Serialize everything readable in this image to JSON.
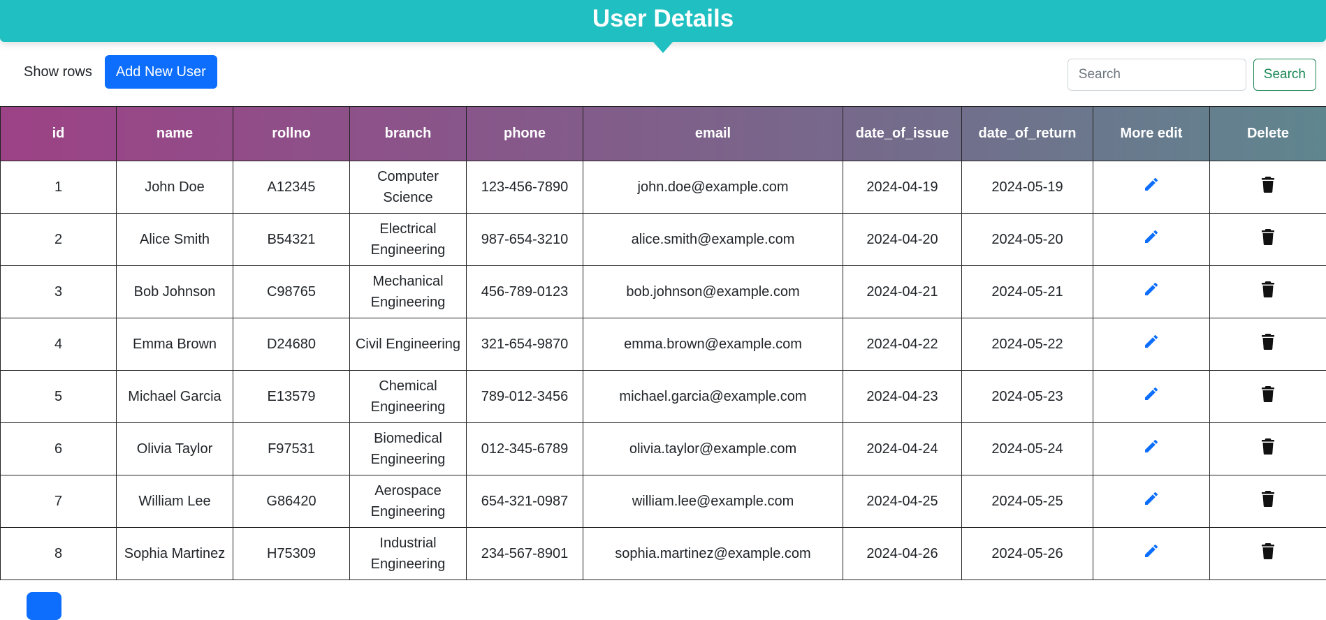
{
  "header": {
    "title": "User Details"
  },
  "toolbar": {
    "show_rows_label": "Show rows",
    "add_user_label": "Add New User",
    "search_placeholder": "Search",
    "search_button_label": "Search"
  },
  "table": {
    "columns": [
      "id",
      "name",
      "rollno",
      "branch",
      "phone",
      "email",
      "date_of_issue",
      "date_of_return",
      "More edit",
      "Delete"
    ],
    "rows": [
      {
        "id": "1",
        "name": "John Doe",
        "rollno": "A12345",
        "branch": "Computer Science",
        "phone": "123-456-7890",
        "email": "john.doe@example.com",
        "date_of_issue": "2024-04-19",
        "date_of_return": "2024-05-19"
      },
      {
        "id": "2",
        "name": "Alice Smith",
        "rollno": "B54321",
        "branch": "Electrical Engineering",
        "phone": "987-654-3210",
        "email": "alice.smith@example.com",
        "date_of_issue": "2024-04-20",
        "date_of_return": "2024-05-20"
      },
      {
        "id": "3",
        "name": "Bob Johnson",
        "rollno": "C98765",
        "branch": "Mechanical Engineering",
        "phone": "456-789-0123",
        "email": "bob.johnson@example.com",
        "date_of_issue": "2024-04-21",
        "date_of_return": "2024-05-21"
      },
      {
        "id": "4",
        "name": "Emma Brown",
        "rollno": "D24680",
        "branch": "Civil Engineering",
        "phone": "321-654-9870",
        "email": "emma.brown@example.com",
        "date_of_issue": "2024-04-22",
        "date_of_return": "2024-05-22"
      },
      {
        "id": "5",
        "name": "Michael Garcia",
        "rollno": "E13579",
        "branch": "Chemical Engineering",
        "phone": "789-012-3456",
        "email": "michael.garcia@example.com",
        "date_of_issue": "2024-04-23",
        "date_of_return": "2024-05-23"
      },
      {
        "id": "6",
        "name": "Olivia Taylor",
        "rollno": "F97531",
        "branch": "Biomedical Engineering",
        "phone": "012-345-6789",
        "email": "olivia.taylor@example.com",
        "date_of_issue": "2024-04-24",
        "date_of_return": "2024-05-24"
      },
      {
        "id": "7",
        "name": "William Lee",
        "rollno": "G86420",
        "branch": "Aerospace Engineering",
        "phone": "654-321-0987",
        "email": "william.lee@example.com",
        "date_of_issue": "2024-04-25",
        "date_of_return": "2024-05-25"
      },
      {
        "id": "8",
        "name": "Sophia Martinez",
        "rollno": "H75309",
        "branch": "Industrial Engineering",
        "phone": "234-567-8901",
        "email": "sophia.martinez@example.com",
        "date_of_issue": "2024-04-26",
        "date_of_return": "2024-05-26"
      }
    ]
  },
  "icons": {
    "edit": "pencil-icon",
    "delete": "trash-icon"
  },
  "colors": {
    "header_bg": "#20bfc1",
    "primary": "#0d6efd",
    "success": "#198754",
    "edit_icon": "#0d6efd",
    "delete_icon": "#111111"
  }
}
